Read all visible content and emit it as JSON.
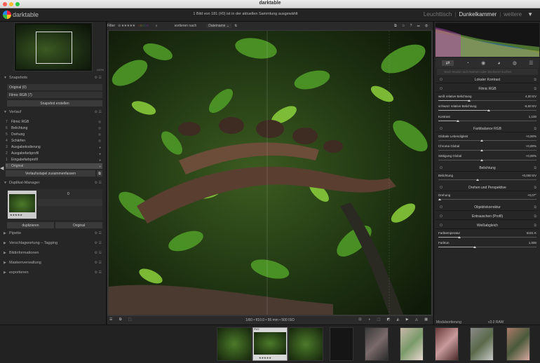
{
  "window": {
    "title": "darktable"
  },
  "app": {
    "name": "darktable",
    "info": "1 Bild von 181 (#0) ist in der aktuellen Sammlung ausgewählt"
  },
  "views": [
    "Leuchttisch",
    "Dunkelkammer",
    "weitere"
  ],
  "views_active": 1,
  "toolbar": {
    "filter_label": "Filter",
    "sort_label": "sortieren nach",
    "sort_value": "Dateiname"
  },
  "navigation": {
    "zoom": "100%"
  },
  "snapshots": {
    "title": "Snapshots",
    "items": [
      "Original (0)",
      "Filmic RGB (7)"
    ],
    "create_button": "Snapshot erstellen"
  },
  "history": {
    "title": "Verlauf",
    "items": [
      {
        "n": "7",
        "label": "Filmic RGB"
      },
      {
        "n": "6",
        "label": "Belichtung"
      },
      {
        "n": "5",
        "label": "Drehung"
      },
      {
        "n": "4",
        "label": "Schärfen"
      },
      {
        "n": "3",
        "label": "Ausgabekodierung"
      },
      {
        "n": "2",
        "label": "Ausgabefarbprofil"
      },
      {
        "n": "1",
        "label": "Eingabefarbprofil"
      },
      {
        "n": "0",
        "label": "Original"
      }
    ],
    "compress_button": "Verlaufsstapel zusammenfassen"
  },
  "duplicates": {
    "title": "Duplikat-Manager",
    "count": "0",
    "thumb_stars": "★★★★★",
    "duplicate_button": "duplizieren",
    "original_button": "Original"
  },
  "collapsed_sections": [
    "Pipette",
    "Verschlagwortung – Tagging",
    "Bildinformationen",
    "Maskenverwaltung",
    "exportieren"
  ],
  "status": {
    "exif": "1/60 • f/10.0 • 55 mm • 500 ISO"
  },
  "modules": {
    "search_placeholder": "Nach Modul nach Namen oder Stichwort suchen",
    "local_contrast": "Lokaler Kontrast",
    "filmic": {
      "title": "Filmic RGB",
      "white_label": "weiß relative Belichtung",
      "white_value": "4,00 EV",
      "black_label": "schwarz relative Belichtung",
      "black_value": "-6,00 EV",
      "contrast_label": "Kontrast",
      "contrast_value": "1,100"
    },
    "colorbalance": {
      "title": "Farbbalance RGB",
      "vib_label": "Globale Lebendigkeit",
      "vib_value": "+0,00%",
      "chroma_label": "Chroma Global",
      "chroma_value": "+0,00%",
      "sat_label": "Sättigung Global",
      "sat_value": "+0,00%"
    },
    "exposure": {
      "title": "Belichtung",
      "label": "Belichtung",
      "value": "+0,000 EV"
    },
    "rotate": {
      "title": "Drehen und Perspektive",
      "label": "Drehung",
      "value": "+0,07°"
    },
    "lens": {
      "title": "Objektivkorrektur"
    },
    "denoise": {
      "title": "Entrauschen (Profil)"
    },
    "whitebalance": {
      "title": "Weißabgleich",
      "temp_label": "Farbtemperatur",
      "temp_value": "6101 K",
      "tint_label": "Farbton",
      "tint_value": "1,000"
    }
  },
  "filmstrip": {
    "module_order_label": "Modulsortierung",
    "module_order_value": "v3.0 RAW",
    "thumb_stars": "★★★★★",
    "thumb_tag": "RW2"
  }
}
